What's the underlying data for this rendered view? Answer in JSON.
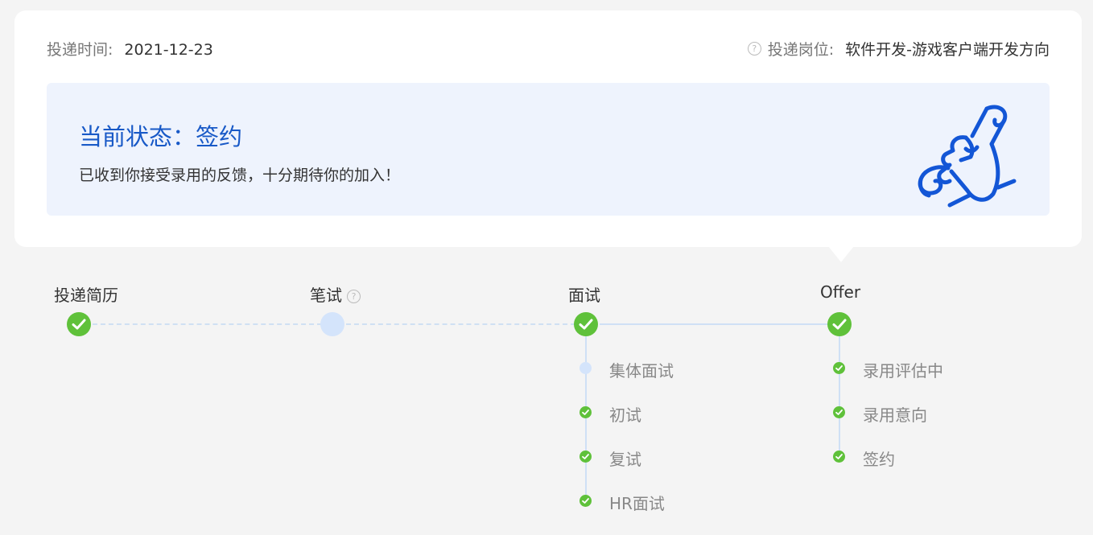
{
  "header": {
    "date_label": "投递时间:",
    "date_value": "2021-12-23",
    "position_label": "投递岗位:",
    "position_value": "软件开发-游戏客户端开发方向",
    "help_icon": "question-circle-icon"
  },
  "status": {
    "title": "当前状态：签约",
    "description": "已收到你接受录用的反馈，十分期待你的加入！",
    "illustration": "handshake-scroll-icon",
    "accent_color": "#1859c7",
    "background_color": "#eef3fd"
  },
  "steps": [
    {
      "label": "投递简历",
      "state": "done"
    },
    {
      "label": "笔试",
      "state": "pending",
      "has_help": true
    },
    {
      "label": "面试",
      "state": "done"
    },
    {
      "label": "Offer",
      "state": "done"
    }
  ],
  "interview_substeps": [
    {
      "label": "集体面试",
      "state": "pending"
    },
    {
      "label": "初试",
      "state": "done"
    },
    {
      "label": "复试",
      "state": "done"
    },
    {
      "label": "HR面试",
      "state": "done"
    }
  ],
  "offer_substeps": [
    {
      "label": "录用评估中",
      "state": "done"
    },
    {
      "label": "录用意向",
      "state": "done"
    },
    {
      "label": "签约",
      "state": "done"
    }
  ],
  "colors": {
    "done": "#5fc13a",
    "pending": "#d4e4fb"
  }
}
